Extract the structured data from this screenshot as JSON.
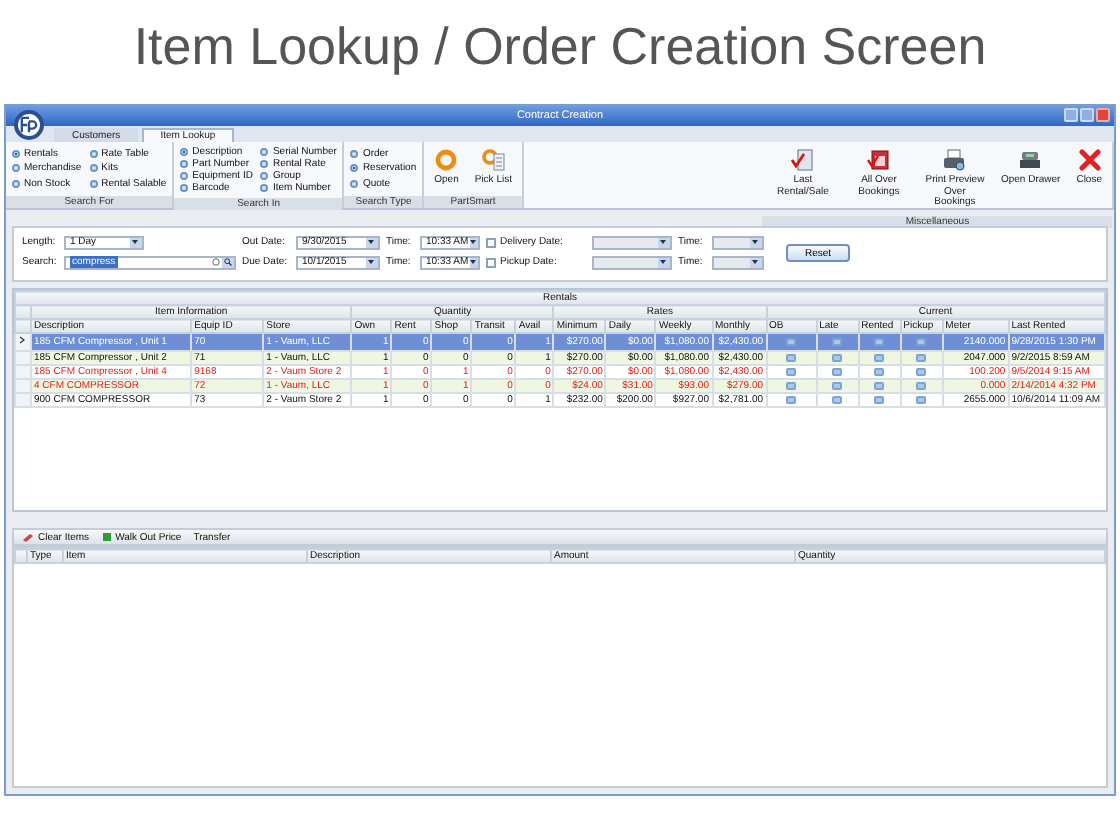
{
  "page_title": "Item Lookup / Order Creation Screen",
  "window": {
    "title": "Contract Creation"
  },
  "tabs": [
    {
      "label": "Customers",
      "selected": false
    },
    {
      "label": "Item Lookup",
      "selected": true
    }
  ],
  "ribbon": [
    {
      "kind": "radio",
      "label": "Search For",
      "columns": [
        [
          {
            "label": "Rentals",
            "selected": true
          },
          {
            "label": "Merchandise",
            "selected": false
          },
          {
            "label": "Non Stock",
            "selected": false
          }
        ],
        [
          {
            "label": "Rate Table",
            "selected": false
          },
          {
            "label": "Kits",
            "selected": false
          },
          {
            "label": "Rental Salable",
            "selected": false
          }
        ]
      ]
    },
    {
      "kind": "radio",
      "label": "Search In",
      "columns": [
        [
          {
            "label": "Description",
            "selected": true
          },
          {
            "label": "Part Number",
            "selected": false
          },
          {
            "label": "Equipment ID",
            "selected": false
          },
          {
            "label": "Barcode",
            "selected": false
          }
        ],
        [
          {
            "label": "Serial Number",
            "selected": false
          },
          {
            "label": "Rental Rate",
            "selected": false
          },
          {
            "label": "Group",
            "selected": false
          },
          {
            "label": "Item Number",
            "selected": false
          }
        ]
      ]
    },
    {
      "kind": "radio",
      "label": "Search Type",
      "columns": [
        [
          {
            "label": "Order",
            "selected": false
          },
          {
            "label": "Reservation",
            "selected": true
          },
          {
            "label": "Quote",
            "selected": false
          }
        ]
      ]
    },
    {
      "kind": "buttons",
      "label": "PartSmart",
      "buttons": [
        "Open",
        "Pick List"
      ]
    },
    {
      "kind": "spacer"
    },
    {
      "kind": "misc",
      "label": "Miscellaneous",
      "buttons": [
        "Last Rental/Sale",
        "All Over Bookings",
        "Print Preview Over Bookings",
        "Open Drawer",
        "Close"
      ]
    }
  ],
  "filters": {
    "length": {
      "label": "Length:",
      "value": "1 Day"
    },
    "search": {
      "label": "Search:",
      "value": "compress"
    },
    "out_date": {
      "label": "Out Date:",
      "value": "9/30/2015",
      "time_label": "Time:",
      "time": "10:33 AM"
    },
    "due_date": {
      "label": "Due Date:",
      "value": "10/1/2015",
      "time_label": "Time:",
      "time": "10:33 AM"
    },
    "delivery": {
      "label": "Delivery Date:",
      "checked": false,
      "time_label": "Time:"
    },
    "pickup": {
      "label": "Pickup Date:",
      "checked": false,
      "time_label": "Time:"
    },
    "reset": "Reset"
  },
  "grid": {
    "title": "Rentals",
    "groups": [
      {
        "label": "Item Information",
        "columns": [
          {
            "label": "Description",
            "kind": "text"
          },
          {
            "label": "Equip ID",
            "kind": "text"
          },
          {
            "label": "Store",
            "kind": "text"
          }
        ]
      },
      {
        "label": "Quantity",
        "columns": [
          {
            "label": "Own",
            "kind": "number"
          },
          {
            "label": "Rent",
            "kind": "number"
          },
          {
            "label": "Shop",
            "kind": "number"
          },
          {
            "label": "Transit",
            "kind": "number"
          },
          {
            "label": "Avail",
            "kind": "number"
          }
        ]
      },
      {
        "label": "Rates",
        "columns": [
          {
            "label": "Minimum",
            "kind": "number"
          },
          {
            "label": "Daily",
            "kind": "number"
          },
          {
            "label": "Weekly",
            "kind": "number"
          },
          {
            "label": "Monthly",
            "kind": "number"
          }
        ]
      },
      {
        "label": "Current",
        "columns": [
          {
            "label": "OB",
            "kind": "flag"
          },
          {
            "label": "Late",
            "kind": "flag"
          },
          {
            "label": "Rented",
            "kind": "flag"
          },
          {
            "label": "Pickup",
            "kind": "flag"
          },
          {
            "label": "Meter",
            "kind": "number"
          },
          {
            "label": "Last Rented",
            "kind": "text"
          }
        ]
      }
    ],
    "rows": [
      {
        "selected": true,
        "alert": false,
        "cells": [
          "185 CFM Compressor , Unit 1",
          "70",
          "1 - Vaum, LLC",
          "1",
          "0",
          "0",
          "0",
          "1",
          "$270.00",
          "$0.00",
          "$1,080.00",
          "$2,430.00",
          "2140.000",
          "9/28/2015 1:30 PM"
        ]
      },
      {
        "selected": false,
        "alert": false,
        "cells": [
          "185 CFM Compressor , Unit 2",
          "71",
          "1 - Vaum, LLC",
          "1",
          "0",
          "0",
          "0",
          "1",
          "$270.00",
          "$0.00",
          "$1,080.00",
          "$2,430.00",
          "2047.000",
          "9/2/2015 8:59 AM"
        ]
      },
      {
        "selected": false,
        "alert": true,
        "cells": [
          "185 CFM Compressor , Unit 4",
          "9168",
          "2 - Vaum Store 2",
          "1",
          "0",
          "1",
          "0",
          "0",
          "$270.00",
          "$0.00",
          "$1,080.00",
          "$2,430.00",
          "100.200",
          "9/5/2014 9:15 AM"
        ]
      },
      {
        "selected": false,
        "alert": true,
        "cells": [
          "4 CFM COMPRESSOR",
          "72",
          "1 - Vaum, LLC",
          "1",
          "0",
          "1",
          "0",
          "0",
          "$24.00",
          "$31.00",
          "$93.00",
          "$279.00",
          "0.000",
          "2/14/2014 4:32 PM"
        ]
      },
      {
        "selected": false,
        "alert": false,
        "cells": [
          "900 CFM COMPRESSOR",
          "73",
          "2 - Vaum Store 2",
          "1",
          "0",
          "0",
          "0",
          "1",
          "$232.00",
          "$200.00",
          "$927.00",
          "$2,781.00",
          "2655.000",
          "10/6/2014 11:09 AM"
        ]
      }
    ]
  },
  "toolbar": [
    "Clear Items",
    "Walk Out Price",
    "Transfer"
  ],
  "order_table": {
    "columns": [
      "Type",
      "Item",
      "Description",
      "Amount",
      "Quantity"
    ]
  }
}
